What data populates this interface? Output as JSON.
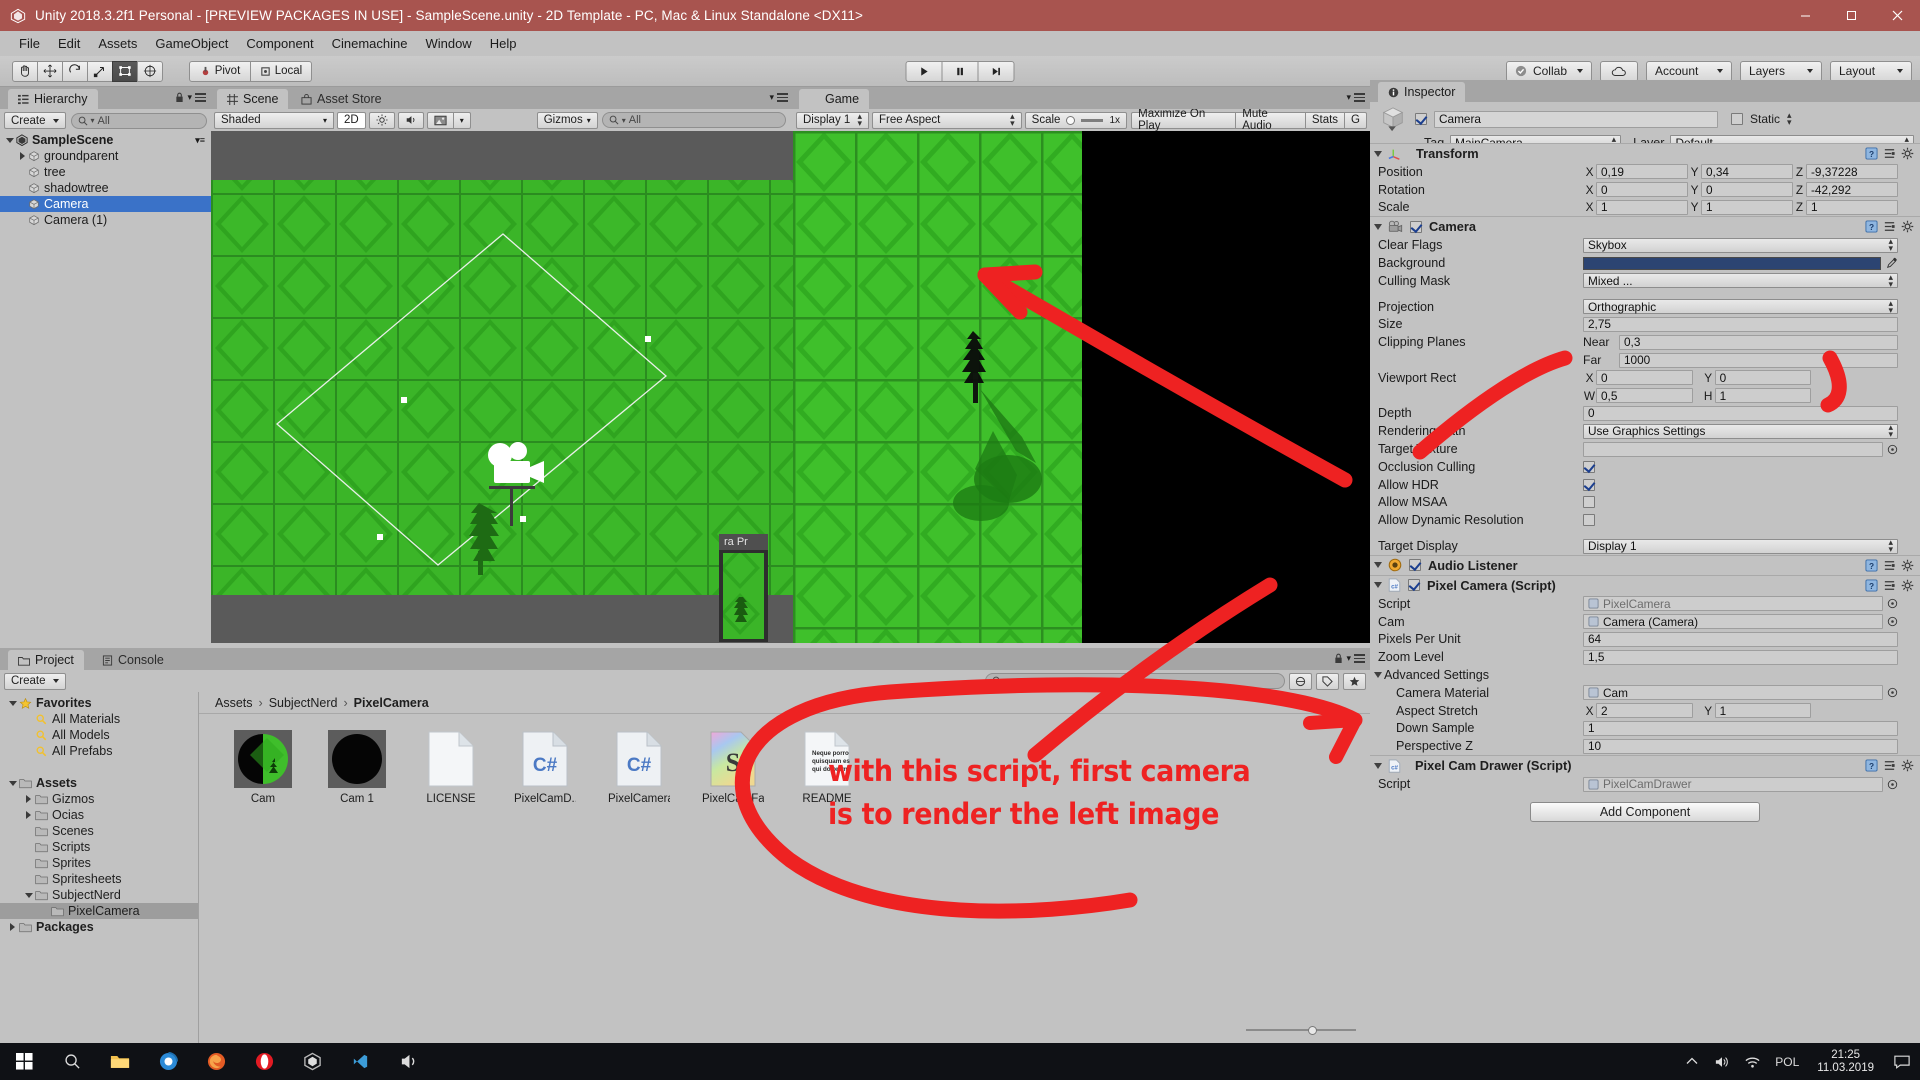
{
  "window": {
    "title": "Unity 2018.3.2f1 Personal - [PREVIEW PACKAGES IN USE] - SampleScene.unity - 2D Template - PC, Mac & Linux Standalone <DX11>",
    "minimize": "─",
    "maximize": "□",
    "close": "✕"
  },
  "menubar": {
    "items": [
      "File",
      "Edit",
      "Assets",
      "GameObject",
      "Component",
      "Cinemachine",
      "Window",
      "Help"
    ]
  },
  "toolbar": {
    "tools": [
      "hand-tool",
      "move-tool",
      "rotate-tool",
      "scale-tool",
      "rect-tool",
      "transform-tool"
    ],
    "pivot_label": "Pivot",
    "space_label": "Local",
    "play": "▶",
    "pause": "❚❚",
    "step": "▶❙",
    "collab_label": "Collab",
    "cloud_label": "cloud",
    "account_label": "Account",
    "layers_label": "Layers",
    "layout_label": "Layout"
  },
  "hierarchy": {
    "tab": "Hierarchy",
    "create_label": "Create",
    "search_placeholder": "All",
    "scene_name": "SampleScene",
    "items": [
      {
        "label": "groundparent",
        "indent": 1,
        "expandable": true,
        "selected": false
      },
      {
        "label": "tree",
        "indent": 1,
        "expandable": false,
        "selected": false
      },
      {
        "label": "shadowtree",
        "indent": 1,
        "expandable": false,
        "selected": false
      },
      {
        "label": "Camera",
        "indent": 1,
        "expandable": false,
        "selected": true
      },
      {
        "label": "Camera (1)",
        "indent": 1,
        "expandable": false,
        "selected": false
      }
    ]
  },
  "scene_view": {
    "tabs": [
      {
        "label": "Scene",
        "active": true
      },
      {
        "label": "Asset Store",
        "active": false
      }
    ],
    "shading_mode": "Shaded",
    "mode_2d": "2D",
    "gizmos_label": "Gizmos",
    "search_placeholder": "All",
    "camera_preview_title": "ra Pr"
  },
  "game_view": {
    "tab": "Game",
    "display": "Display 1",
    "aspect": "Free Aspect",
    "scale_label": "Scale",
    "scale_value": "1x",
    "maximize_on_play": "Maximize On Play",
    "mute_audio": "Mute Audio",
    "stats": "Stats",
    "gizmos": "G"
  },
  "inspector": {
    "tab": "Inspector",
    "object_name": "Camera",
    "object_enabled": true,
    "static_label": "Static",
    "tag_label": "Tag",
    "tag_value": "MainCamera",
    "layer_label": "Layer",
    "layer_value": "Default",
    "components": [
      {
        "name": "Transform",
        "type": "transform",
        "rows": [
          {
            "label": "Position",
            "kind": "xyz",
            "x": "0,19",
            "y": "0,34",
            "z": "-9,37228"
          },
          {
            "label": "Rotation",
            "kind": "xyz",
            "x": "0",
            "y": "0",
            "z": "-42,292"
          },
          {
            "label": "Scale",
            "kind": "xyz",
            "x": "1",
            "y": "1",
            "z": "1"
          }
        ]
      },
      {
        "name": "Camera",
        "type": "camera",
        "enabled": true,
        "rows": [
          {
            "label": "Clear Flags",
            "kind": "dropdown",
            "value": "Skybox"
          },
          {
            "label": "Background",
            "kind": "color",
            "value": "#2c4472"
          },
          {
            "label": "Culling Mask",
            "kind": "dropdown",
            "value": "Mixed ..."
          },
          {
            "label": "",
            "kind": "spacer"
          },
          {
            "label": "Projection",
            "kind": "dropdown",
            "value": "Orthographic"
          },
          {
            "label": "Size",
            "kind": "text",
            "value": "2,75"
          },
          {
            "label": "Clipping Planes",
            "kind": "labeled",
            "sub_label": "Near",
            "value": "0,3"
          },
          {
            "label": "",
            "kind": "labeled",
            "sub_label": "Far",
            "value": "1000"
          },
          {
            "label": "Viewport Rect",
            "kind": "pair",
            "a_label": "X",
            "a": "0",
            "b_label": "Y",
            "b": "0"
          },
          {
            "label": "",
            "kind": "pair",
            "a_label": "W",
            "a": "0,5",
            "b_label": "H",
            "b": "1"
          },
          {
            "label": "Depth",
            "kind": "text",
            "value": "0"
          },
          {
            "label": "Rendering Path",
            "kind": "dropdown",
            "value": "Use Graphics Settings"
          },
          {
            "label": "Target Texture",
            "kind": "object",
            "value": ""
          },
          {
            "label": "Occlusion Culling",
            "kind": "checkbox",
            "checked": true
          },
          {
            "label": "Allow HDR",
            "kind": "checkbox",
            "checked": true
          },
          {
            "label": "Allow MSAA",
            "kind": "checkbox",
            "checked": false
          },
          {
            "label": "Allow Dynamic Resolution",
            "kind": "checkbox",
            "checked": false
          },
          {
            "label": "",
            "kind": "spacer"
          },
          {
            "label": "Target Display",
            "kind": "dropdown",
            "value": "Display 1"
          }
        ]
      },
      {
        "name": "Audio Listener",
        "type": "audio",
        "enabled": true,
        "rows": []
      },
      {
        "name": "Pixel Camera (Script)",
        "type": "script",
        "enabled": true,
        "rows": [
          {
            "label": "Script",
            "kind": "object",
            "value": "PixelCamera",
            "disabled": true
          },
          {
            "label": "Cam",
            "kind": "object",
            "value": "Camera (Camera)"
          },
          {
            "label": "Pixels Per Unit",
            "kind": "text",
            "value": "64"
          },
          {
            "label": "Zoom Level",
            "kind": "text",
            "value": "1,5"
          },
          {
            "label": "Advanced Settings",
            "kind": "foldout"
          },
          {
            "label": "Camera Material",
            "kind": "object",
            "value": "Cam",
            "indent": true
          },
          {
            "label": "Aspect Stretch",
            "kind": "pair",
            "a_label": "X",
            "a": "2",
            "b_label": "Y",
            "b": "1",
            "indent": true
          },
          {
            "label": "Down Sample",
            "kind": "text",
            "value": "1",
            "indent": true
          },
          {
            "label": "Perspective Z",
            "kind": "text",
            "value": "10",
            "indent": true
          }
        ]
      },
      {
        "name": "Pixel Cam Drawer (Script)",
        "type": "script",
        "rows": [
          {
            "label": "Script",
            "kind": "object",
            "value": "PixelCamDrawer",
            "disabled": true
          }
        ]
      }
    ],
    "add_component_label": "Add Component"
  },
  "project": {
    "tabs": [
      {
        "label": "Project",
        "active": true
      },
      {
        "label": "Console",
        "active": false
      }
    ],
    "create_label": "Create",
    "search_placeholder": "",
    "tree": [
      {
        "label": "Favorites",
        "indent": 0,
        "icon": "star",
        "bold": true,
        "arrow": "down"
      },
      {
        "label": "All Materials",
        "indent": 1,
        "icon": "search",
        "bold": false,
        "arrow": ""
      },
      {
        "label": "All Models",
        "indent": 1,
        "icon": "search",
        "bold": false,
        "arrow": ""
      },
      {
        "label": "All Prefabs",
        "indent": 1,
        "icon": "search",
        "bold": false,
        "arrow": ""
      },
      {
        "label": "",
        "indent": 0,
        "icon": "",
        "bold": false,
        "arrow": ""
      },
      {
        "label": "Assets",
        "indent": 0,
        "icon": "folder",
        "bold": true,
        "arrow": "down"
      },
      {
        "label": "Gizmos",
        "indent": 1,
        "icon": "folder",
        "bold": false,
        "arrow": "right"
      },
      {
        "label": "Ocias",
        "indent": 1,
        "icon": "folder",
        "bold": false,
        "arrow": "right"
      },
      {
        "label": "Scenes",
        "indent": 1,
        "icon": "folder",
        "bold": false,
        "arrow": ""
      },
      {
        "label": "Scripts",
        "indent": 1,
        "icon": "folder",
        "bold": false,
        "arrow": ""
      },
      {
        "label": "Sprites",
        "indent": 1,
        "icon": "folder",
        "bold": false,
        "arrow": ""
      },
      {
        "label": "Spritesheets",
        "indent": 1,
        "icon": "folder",
        "bold": false,
        "arrow": ""
      },
      {
        "label": "SubjectNerd",
        "indent": 1,
        "icon": "folder",
        "bold": false,
        "arrow": "down"
      },
      {
        "label": "PixelCamera",
        "indent": 2,
        "icon": "folder",
        "bold": false,
        "arrow": "",
        "selected": true
      },
      {
        "label": "Packages",
        "indent": 0,
        "icon": "folder",
        "bold": true,
        "arrow": "right"
      }
    ],
    "breadcrumb": [
      "Assets",
      "SubjectNerd",
      "PixelCamera"
    ],
    "assets": [
      {
        "name": "Cam",
        "type": "material-split"
      },
      {
        "name": "Cam 1",
        "type": "material-black"
      },
      {
        "name": "LICENSE",
        "type": "text-file"
      },
      {
        "name": "PixelCamD...",
        "type": "csharp"
      },
      {
        "name": "PixelCamera",
        "type": "csharp"
      },
      {
        "name": "PixelCamFa...",
        "type": "shader"
      },
      {
        "name": "README",
        "type": "readme"
      }
    ],
    "readme_lines": [
      "Neque porro",
      "quisquam est",
      "qui dolorem."
    ]
  },
  "annotations": {
    "text_lines": [
      "with this script, first camera",
      "is to render the left image"
    ],
    "color": "#ee2222"
  },
  "taskbar": {
    "apps": [
      "start-icon",
      "search-icon",
      "task-view-icon",
      "browser-icon",
      "firefox-icon",
      "opera-icon",
      "unity-hub-icon",
      "vscode-icon",
      "audio-app-icon"
    ],
    "lang": "POL",
    "time": "21:25",
    "date": "11.03.2019"
  }
}
